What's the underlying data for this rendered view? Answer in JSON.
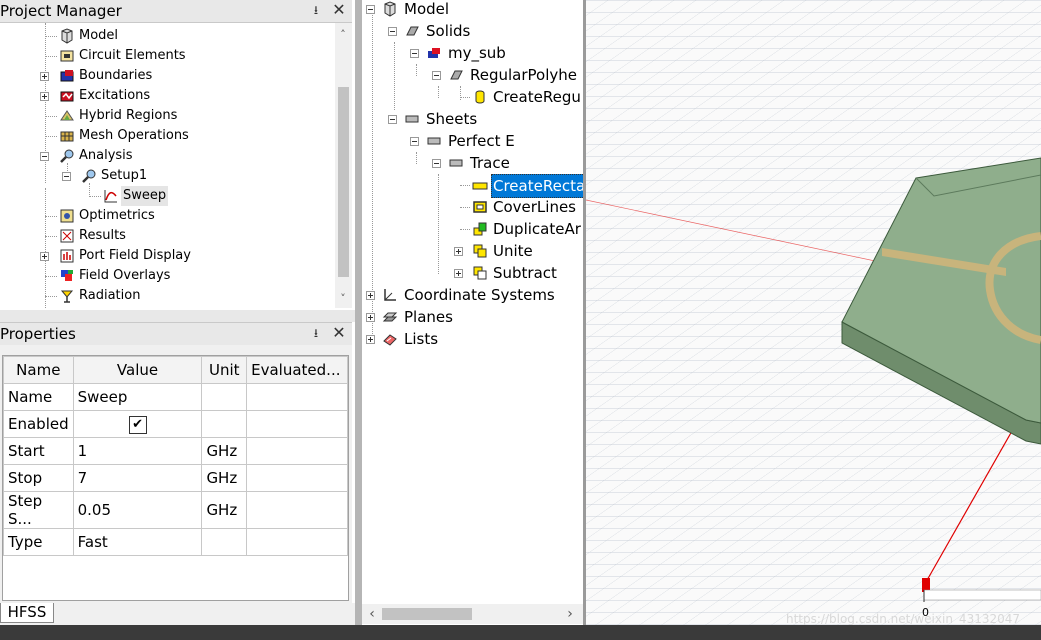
{
  "project_manager": {
    "title": "Project Manager",
    "pin": "⭳",
    "close": "✕",
    "items": [
      {
        "label": "Model",
        "icon": "model-icon"
      },
      {
        "label": "Circuit Elements",
        "icon": "circuit-icon"
      },
      {
        "label": "Boundaries",
        "icon": "boundaries-icon"
      },
      {
        "label": "Excitations",
        "icon": "excitations-icon"
      },
      {
        "label": "Hybrid Regions",
        "icon": "hybrid-icon"
      },
      {
        "label": "Mesh Operations",
        "icon": "mesh-icon"
      },
      {
        "label": "Analysis",
        "icon": "analysis-icon"
      },
      {
        "label": "Setup1",
        "icon": "setup-icon"
      },
      {
        "label": "Sweep",
        "icon": "sweep-icon"
      },
      {
        "label": "Optimetrics",
        "icon": "optimetrics-icon"
      },
      {
        "label": "Results",
        "icon": "results-icon"
      },
      {
        "label": "Port Field Display",
        "icon": "port-field-icon"
      },
      {
        "label": "Field Overlays",
        "icon": "field-overlays-icon"
      },
      {
        "label": "Radiation",
        "icon": "radiation-icon"
      }
    ]
  },
  "properties": {
    "title": "Properties",
    "headers": [
      "Name",
      "Value",
      "Unit",
      "Evaluated..."
    ],
    "rows": [
      {
        "name": "Name",
        "value": "Sweep",
        "unit": "",
        "evaluated": ""
      },
      {
        "name": "Enabled",
        "value": "✔",
        "unit": "",
        "evaluated": ""
      },
      {
        "name": "Start",
        "value": "1",
        "unit": "GHz",
        "evaluated": ""
      },
      {
        "name": "Stop",
        "value": "7",
        "unit": "GHz",
        "evaluated": ""
      },
      {
        "name": "Step S...",
        "value": "0.05",
        "unit": "GHz",
        "evaluated": ""
      },
      {
        "name": "Type",
        "value": "Fast",
        "unit": "",
        "evaluated": ""
      }
    ],
    "tab": "HFSS"
  },
  "model_tree": {
    "items": [
      {
        "label": "Model"
      },
      {
        "label": "Solids"
      },
      {
        "label": "my_sub"
      },
      {
        "label": "RegularPolyhe"
      },
      {
        "label": "CreateRegu"
      },
      {
        "label": "Sheets"
      },
      {
        "label": "Perfect E"
      },
      {
        "label": "Trace"
      },
      {
        "label": "CreateRecta"
      },
      {
        "label": "CoverLines"
      },
      {
        "label": "DuplicateAr"
      },
      {
        "label": "Unite"
      },
      {
        "label": "Subtract"
      },
      {
        "label": "Coordinate Systems"
      },
      {
        "label": "Planes"
      },
      {
        "label": "Lists"
      }
    ]
  },
  "viewport": {
    "origin_label": "0",
    "watermark": "https://blog.csdn.net/weixin_43132047"
  },
  "colors": {
    "selection": "#0078d7",
    "substrate": "#8fae8c",
    "trace": "#c8b47c",
    "axis_red": "#e00000"
  }
}
